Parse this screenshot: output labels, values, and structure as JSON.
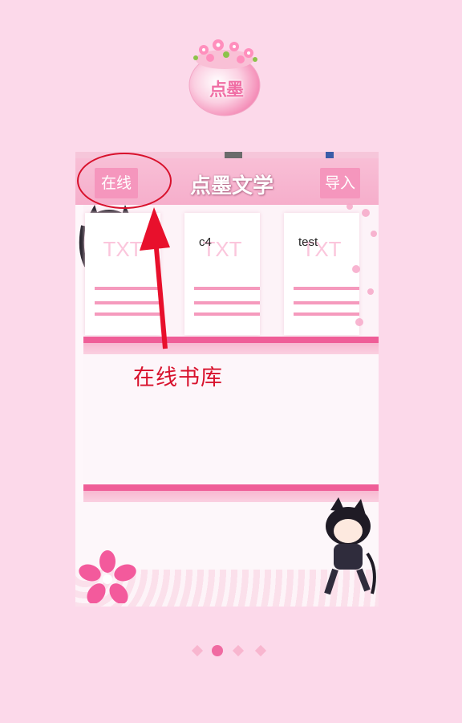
{
  "logo": {
    "text": "点墨",
    "icon": "flower-pot-icon"
  },
  "app": {
    "title": "点墨文学",
    "online_button": "在线",
    "import_button": "导入"
  },
  "books": [
    {
      "name": "",
      "cover_text": "TXT"
    },
    {
      "name": "c4",
      "cover_text": "TXT"
    },
    {
      "name": "test",
      "cover_text": "TXT"
    }
  ],
  "annotation": {
    "label": "在线书库",
    "color": "#d8112c"
  },
  "pagination": {
    "count": 4,
    "active_index": 1
  },
  "colors": {
    "background": "#fcd9ea",
    "accent": "#f06aa1",
    "button": "#f596bd"
  }
}
